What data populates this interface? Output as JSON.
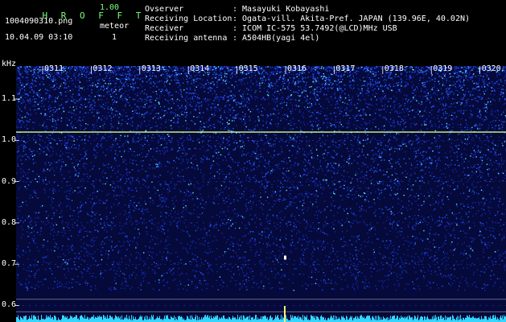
{
  "header": {
    "app_name": "H R O F F T",
    "version": "1.00",
    "filename": "1004090310.png",
    "datetime": "10.04.09 03:10",
    "meteor_label": "meteor",
    "meteor_count": "1",
    "info": [
      {
        "key": "Ovserver",
        "value": ": Masayuki Kobayashi"
      },
      {
        "key": "Receiving Location",
        "value": ": Ogata-vill. Akita-Pref. JAPAN (139.96E, 40.02N)"
      },
      {
        "key": "Receiver",
        "value": ": ICOM IC-575 53.7492(@LCD)MHz USB"
      },
      {
        "key": "Receiving antenna",
        "value": ": A504HB(yagi 4el)"
      }
    ]
  },
  "colors": {
    "header_green": "#7CFF7C",
    "bg": "#000000",
    "noise_blue": "#1a3cff",
    "carrier": "#d8ff7a"
  },
  "chart_data": {
    "type": "heatmap",
    "ylabel": "kHz",
    "yticks": [
      "1.1",
      "1.0",
      "0.9",
      "0.8",
      "0.7",
      "0.6"
    ],
    "xticks": [
      "0311",
      "0312",
      "0313",
      "0314",
      "0315",
      "0316",
      "0317",
      "0318",
      "0319",
      "0320"
    ],
    "ylim": [
      0.56,
      1.2
    ],
    "carrier_line_khz": 1.02,
    "meteor_echo": {
      "time": "0316",
      "khz": 0.715
    }
  }
}
